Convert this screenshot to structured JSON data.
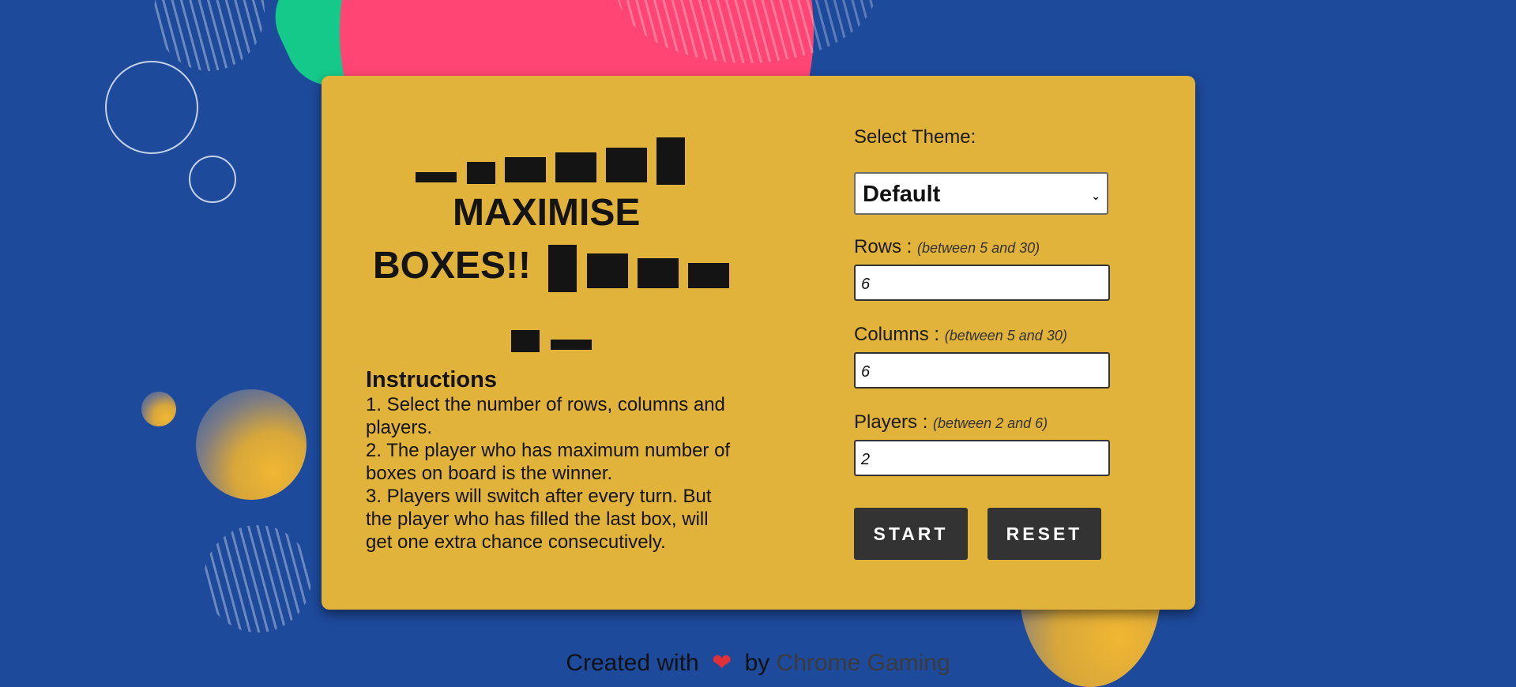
{
  "logo": {
    "title_line1": "MAXIMISE",
    "title_line2": "BOXES!!"
  },
  "instructions": {
    "heading": "Instructions",
    "steps": [
      "1. Select the number of rows, columns and players.",
      "2. The player who has maximum number of boxes on board is the winner.",
      "3. Players will switch after every turn. But the player who has filled the last box, will get one extra chance consecutively."
    ]
  },
  "form": {
    "theme_label": "Select Theme:",
    "theme_value": "Default",
    "rows_label": "Rows :",
    "rows_hint": "(between 5 and 30)",
    "rows_value": "6",
    "columns_label": "Columns :",
    "columns_hint": "(between 5 and 30)",
    "columns_value": "6",
    "players_label": "Players :",
    "players_hint": "(between 2 and 6)",
    "players_value": "2",
    "start_label": "START",
    "reset_label": "RESET"
  },
  "footer": {
    "created_with": "Created with",
    "heart": "❤",
    "by": "by",
    "brand": "Chrome Gaming"
  },
  "colors": {
    "background": "#1e4a9c",
    "card": "#e2b33a",
    "button": "#333333",
    "heart": "#e0303a"
  },
  "icons": [
    "heart-icon",
    "chevron-down-icon"
  ]
}
